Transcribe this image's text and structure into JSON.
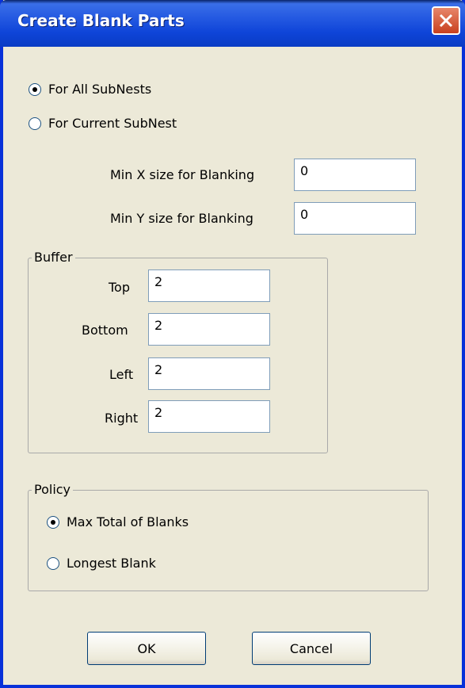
{
  "window": {
    "title": "Create Blank Parts"
  },
  "scope": {
    "options": [
      {
        "label": "For All SubNests",
        "checked": true
      },
      {
        "label": "For Current SubNest",
        "checked": false
      }
    ]
  },
  "min_size": {
    "x_label": "Min X size for Blanking",
    "x_value": "0",
    "y_label": "Min Y size for Blanking",
    "y_value": "0"
  },
  "buffer": {
    "legend": "Buffer",
    "top_label": "Top",
    "top_value": "2",
    "bottom_label": "Bottom",
    "bottom_value": "2",
    "left_label": "Left",
    "left_value": "2",
    "right_label": "Right",
    "right_value": "2"
  },
  "policy": {
    "legend": "Policy",
    "options": [
      {
        "label": "Max Total of Blanks",
        "checked": true
      },
      {
        "label": "Longest Blank",
        "checked": false
      }
    ]
  },
  "buttons": {
    "ok": "OK",
    "cancel": "Cancel"
  }
}
